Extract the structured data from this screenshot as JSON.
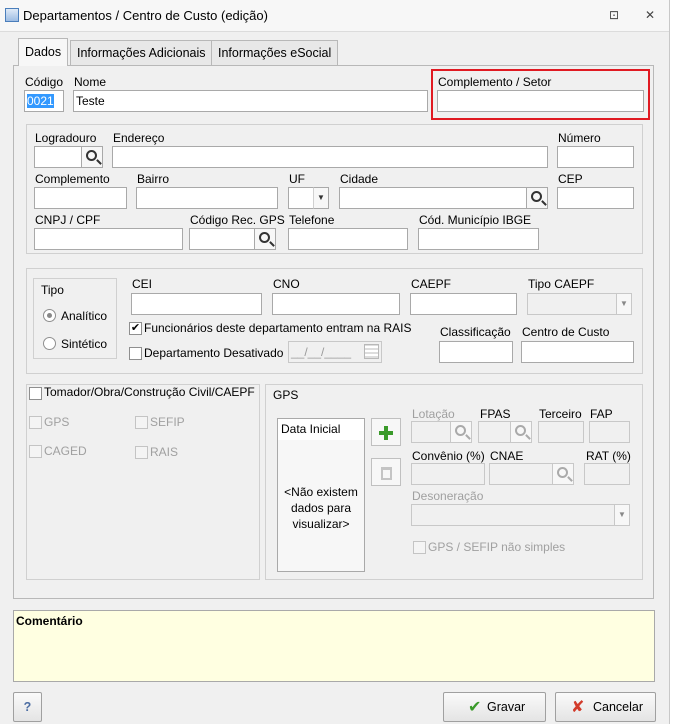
{
  "window": {
    "title": "Departamentos / Centro de Custo (edição)",
    "restore_glyph": "⊡",
    "close_glyph": "✕"
  },
  "tabs": [
    "Dados",
    "Informações Adicionais",
    "Informações eSocial"
  ],
  "fields": {
    "codigo_label": "Código",
    "codigo_value": "0021",
    "nome_label": "Nome",
    "nome_value": "Teste",
    "complemento_setor_label": "Complemento / Setor",
    "logradouro_label": "Logradouro",
    "endereco_label": "Endereço",
    "numero_label": "Número",
    "complemento_label": "Complemento",
    "bairro_label": "Bairro",
    "uf_label": "UF",
    "cidade_label": "Cidade",
    "cep_label": "CEP",
    "cnpj_label": "CNPJ / CPF",
    "codigo_rec_gps_label": "Código Rec. GPS",
    "telefone_label": "Telefone",
    "cod_municipio_label": "Cód. Município IBGE"
  },
  "tipo": {
    "label": "Tipo",
    "options": [
      "Analítico",
      "Sintético"
    ],
    "selected": "Analítico"
  },
  "registros": {
    "cei_label": "CEI",
    "cno_label": "CNO",
    "caepf_label": "CAEPF",
    "tipo_caepf_label": "Tipo CAEPF",
    "rais_check_label": "Funcionários deste departamento entram na RAIS",
    "desativado_label": "Departamento Desativado",
    "date_placeholder": "__/__/____",
    "classificacao_label": "Classificação",
    "centro_custo_label": "Centro de Custo"
  },
  "tomador": {
    "label": "Tomador/Obra/Construção Civil/CAEPF",
    "options": [
      "GPS",
      "SEFIP",
      "CAGED",
      "RAIS"
    ]
  },
  "gps": {
    "title": "GPS",
    "grid_header": "Data Inicial",
    "empty_text": "<Não existem dados para visualizar>",
    "lotacao_label": "Lotação",
    "fpas_label": "FPAS",
    "terceiro_label": "Terceiro",
    "fap_label": "FAP",
    "convenio_label": "Convênio (%)",
    "cnae_label": "CNAE",
    "rat_label": "RAT (%)",
    "desoneracao_label": "Desoneração",
    "nao_simples_label": "GPS / SEFIP não simples"
  },
  "comentario": {
    "label": "Comentário"
  },
  "buttons": {
    "help": "?",
    "gravar": "Gravar",
    "cancelar": "Cancelar"
  },
  "colors": {
    "highlight": "#e01a22",
    "comment_bg": "#ffffe1",
    "selection": "#3399ff",
    "add_icon": "#3a9a2a",
    "cancel_icon": "#d23b2b"
  }
}
